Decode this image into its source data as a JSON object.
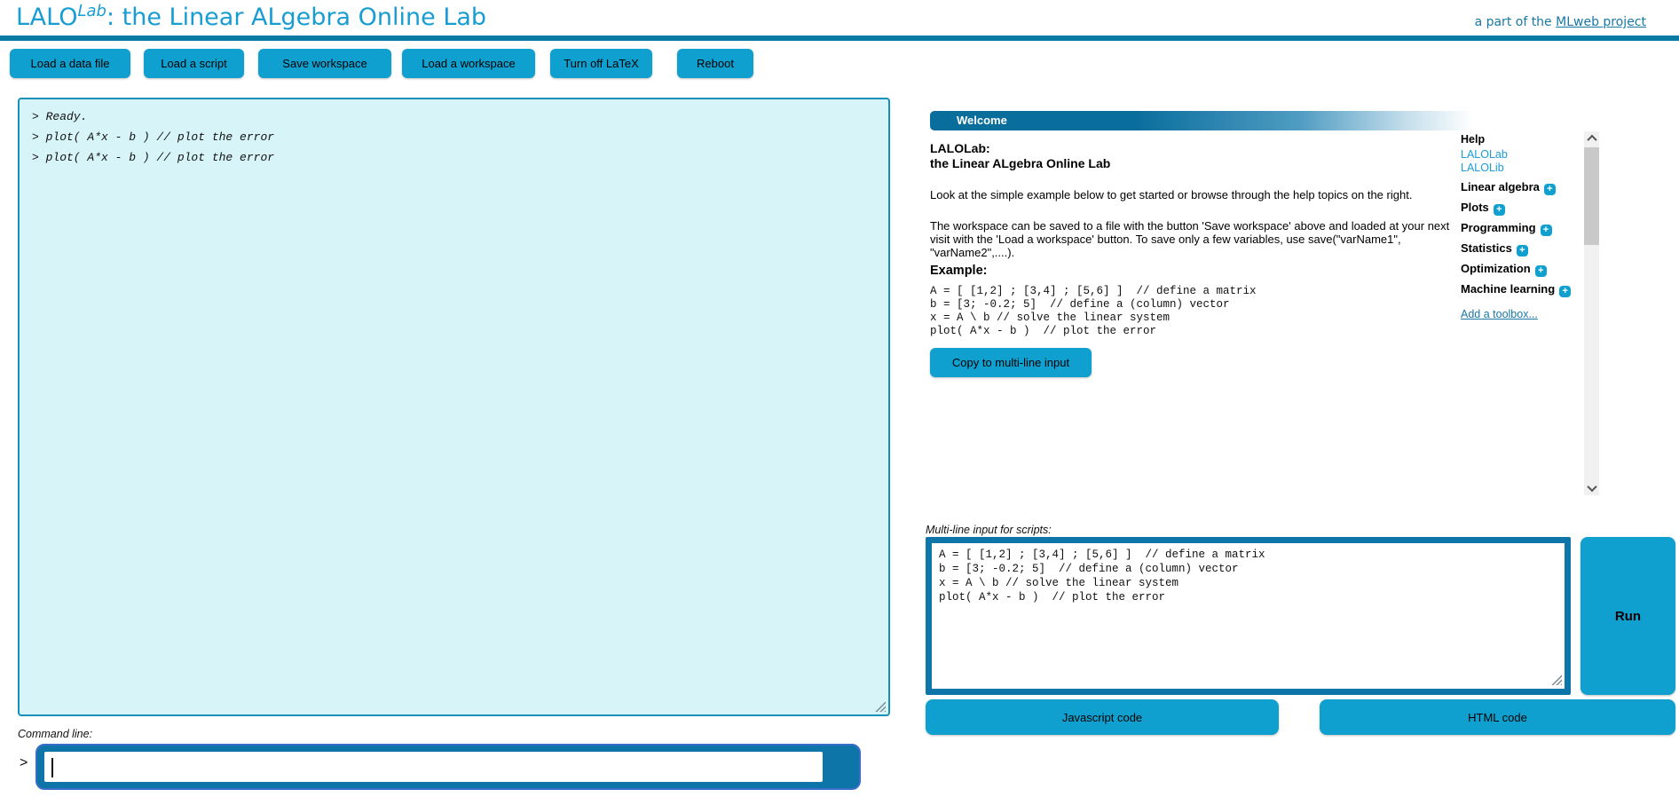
{
  "header": {
    "title_main": "LALO",
    "title_sup": "Lab",
    "title_rest": ": the Linear ALgebra Online Lab",
    "mlweb_prefix": "a part of the ",
    "mlweb_link": "MLweb project"
  },
  "toolbar": {
    "buttons": [
      "Load a data file",
      "Load a script",
      "Save workspace",
      "Load a workspace",
      "Turn off LaTeX",
      "Reboot"
    ]
  },
  "console": {
    "lines": [
      "> Ready.",
      "> plot( A*x - b ) // plot the error",
      "> plot( A*x - b ) // plot the error"
    ]
  },
  "command_line": {
    "label": "Command line:",
    "prompt": ">",
    "value": ""
  },
  "welcome": {
    "header": "Welcome",
    "heading_line1": "LALOLab:",
    "heading_line2": "the Linear ALgebra Online Lab",
    "paragraph1": "Look at the simple example below to get started or browse through the help topics on the right.",
    "paragraph2": "The workspace can be saved to a file with the button 'Save workspace' above and loaded at your next visit with the 'Load a workspace' button. To save only a few variables, use save(\"varName1\", \"varName2\",....).",
    "example_label": "Example:",
    "example_code": "A = [ [1,2] ; [3,4] ; [5,6] ]  // define a matrix\nb = [3; -0.2; 5]  // define a (column) vector\nx = A \\ b // solve the linear system\nplot( A*x - b )  // plot the error",
    "copy_button": "Copy to multi-line input"
  },
  "help": {
    "title": "Help",
    "links": [
      "LALOLab",
      "LALOLib"
    ],
    "topics": [
      "Linear algebra",
      "Plots",
      "Programming",
      "Statistics",
      "Optimization",
      "Machine learning"
    ],
    "expand_icon": "+",
    "add_toolbox": "Add a toolbox..."
  },
  "script_input": {
    "label": "Multi-line input for scripts:",
    "value": "A = [ [1,2] ; [3,4] ; [5,6] ]  // define a matrix\nb = [3; -0.2; 5]  // define a (column) vector\nx = A \\ b // solve the linear system\nplot( A*x - b )  // plot the error",
    "run_button": "Run",
    "js_button": "Javascript code",
    "html_button": "HTML code"
  },
  "colors": {
    "accent": "#10a0cf",
    "dark_teal": "#0d75a7",
    "title_blue": "#189dd3",
    "console_bg": "#d7f4f9",
    "link": "#1a9cd5"
  }
}
